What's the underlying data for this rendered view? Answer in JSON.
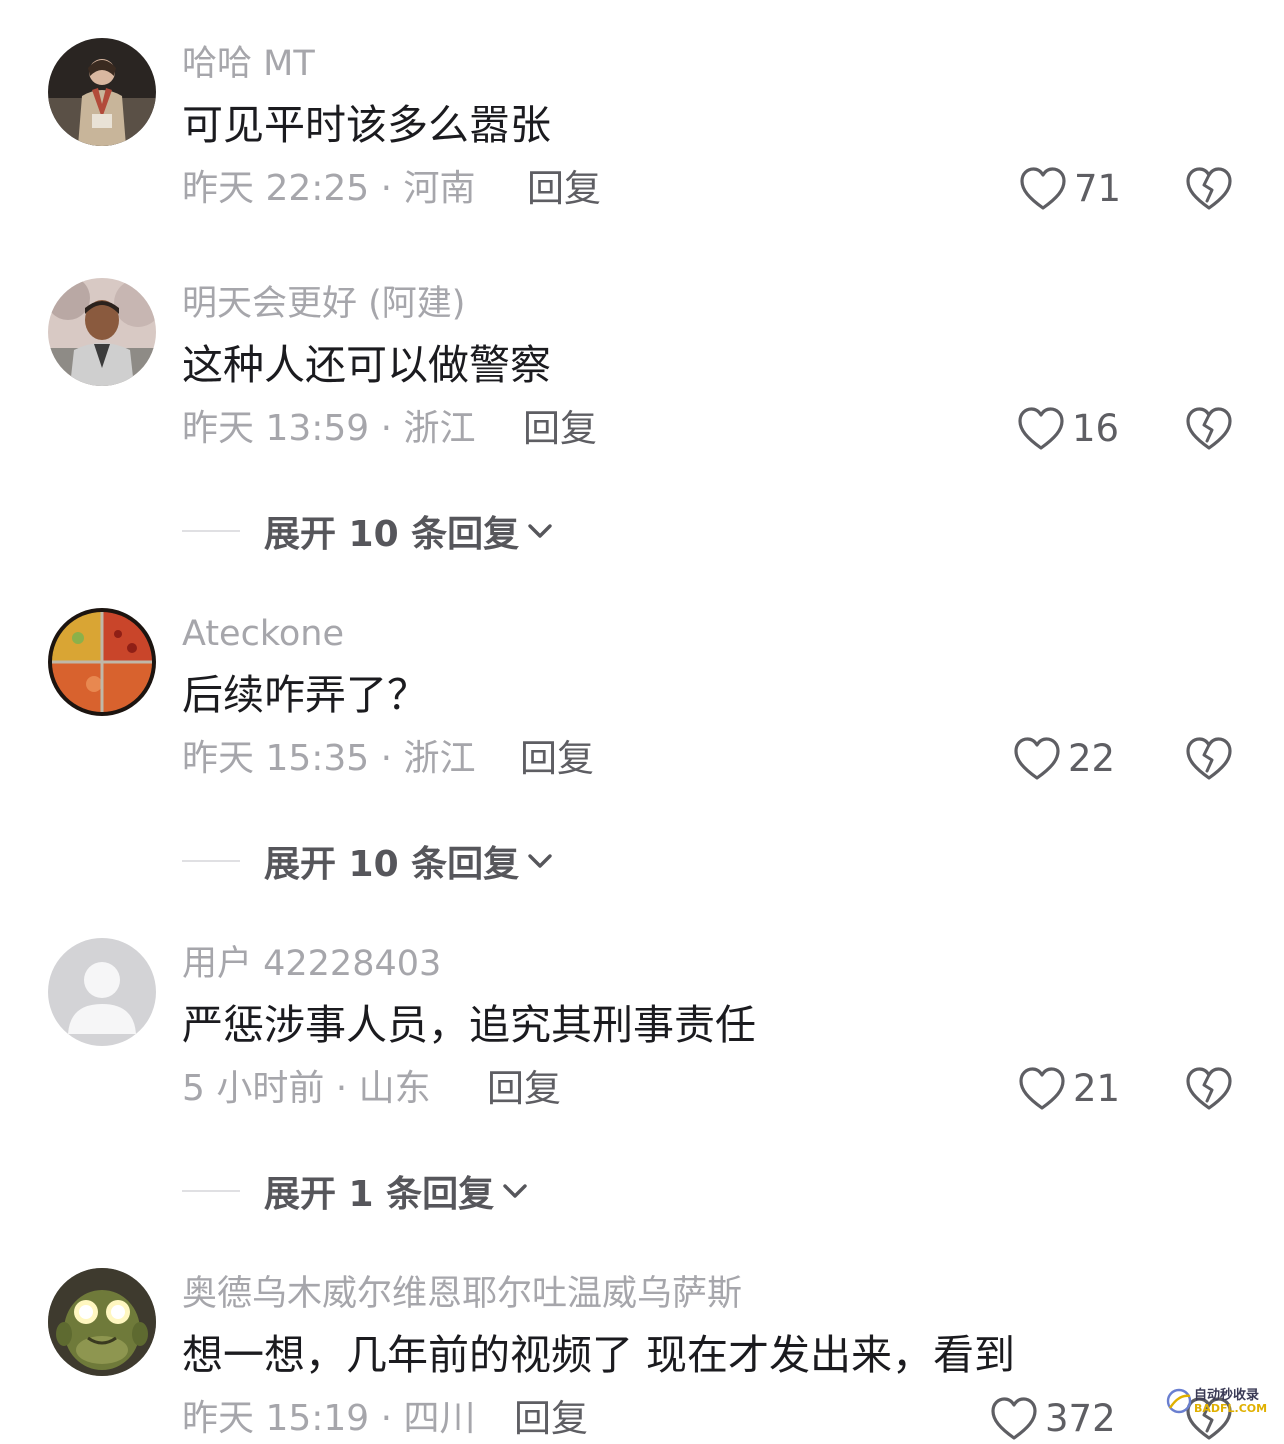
{
  "comments": [
    {
      "username": "哈哈 MT",
      "content": "可见平时该多么嚣张",
      "time_location": "昨天 22:25 · 河南",
      "reply_label": "回复",
      "likes": "71"
    },
    {
      "username": "明天会更好 (阿建)",
      "content": "这种人还可以做警察",
      "time_location": "昨天 13:59 · 浙江",
      "reply_label": "回复",
      "likes": "16",
      "expand_label": "展开 10 条回复"
    },
    {
      "username": "Ateckone",
      "content": "后续咋弄了？",
      "time_location": "昨天 15:35 · 浙江",
      "reply_label": "回复",
      "likes": "22",
      "expand_label": "展开 10 条回复"
    },
    {
      "username": "用户 42228403",
      "content": "严惩涉事人员，追究其刑事责任",
      "time_location": "5 小时前 · 山东",
      "reply_label": "回复",
      "likes": "21",
      "expand_label": "展开 1 条回复"
    },
    {
      "username": "奥德乌木威尔维恩耶尔吐温威乌萨斯",
      "content": "想一想，几年前的视频了 现在才发出来，看到",
      "time_location": "昨天 15:19 · 四川",
      "reply_label": "回复",
      "likes": "372"
    }
  ],
  "watermark": {
    "text": "自动秒收录",
    "sub": "BADFL.COM"
  },
  "colors": {
    "text_primary": "#1b1b1f",
    "text_secondary": "#a6a6ab",
    "action": "#5e5e63"
  }
}
